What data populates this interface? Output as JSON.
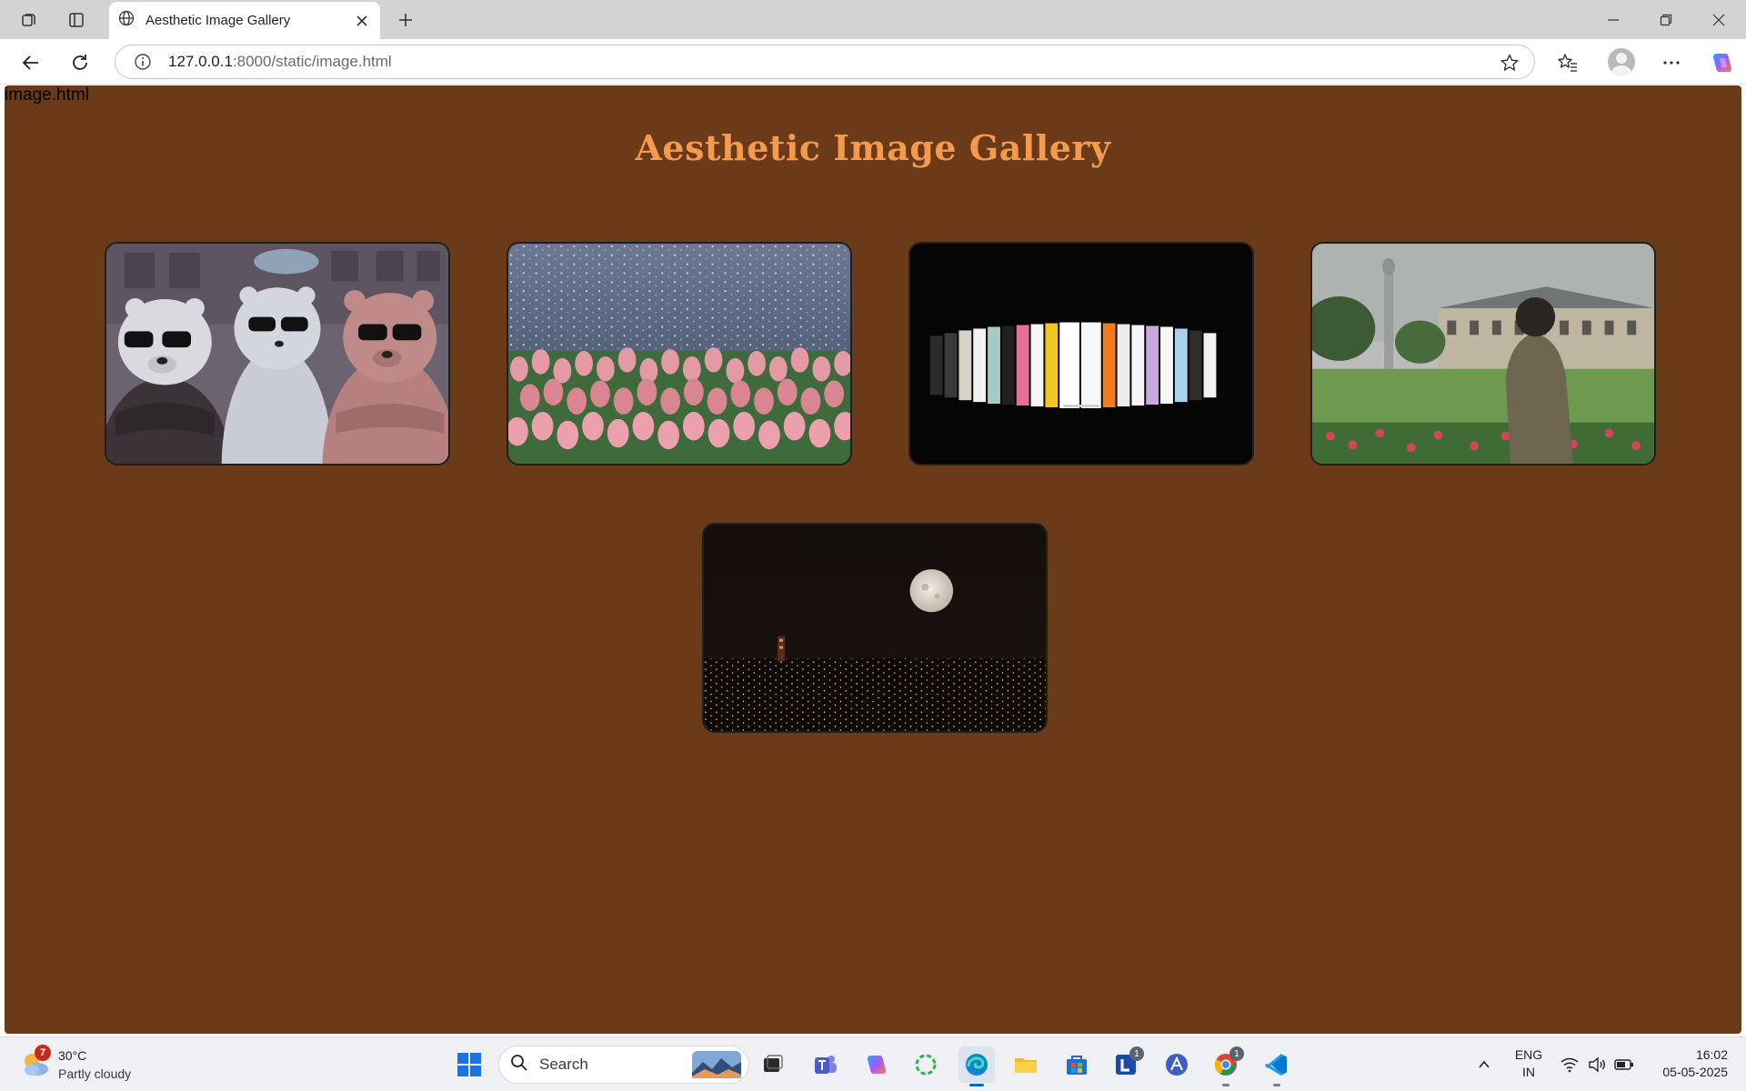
{
  "browser": {
    "tab": {
      "title": "Aesthetic Image Gallery"
    },
    "address": {
      "host": "127.0.0.1",
      "rest": ":8000/static/image.html"
    }
  },
  "page": {
    "file_label": "image.html",
    "title": "Aesthetic Image Gallery",
    "colors": {
      "background": "#6b3a18",
      "title": "#f39a4e",
      "card_border": "#1f1f1f"
    },
    "images": [
      {
        "name": "cartoon-bears-image"
      },
      {
        "name": "tulips-by-water-image"
      },
      {
        "name": "album-covers-image"
      },
      {
        "name": "palace-garden-image"
      },
      {
        "name": "moon-city-night-image"
      }
    ]
  },
  "taskbar": {
    "weather": {
      "badge": "7",
      "temp": "30°C",
      "desc": "Partly cloudy"
    },
    "search": {
      "label": "Search"
    },
    "badges": {
      "lens": "1",
      "chrome": "1"
    },
    "lang": {
      "line1": "ENG",
      "line2": "IN"
    },
    "clock": {
      "time": "16:02",
      "date": "05-05-2025"
    }
  }
}
